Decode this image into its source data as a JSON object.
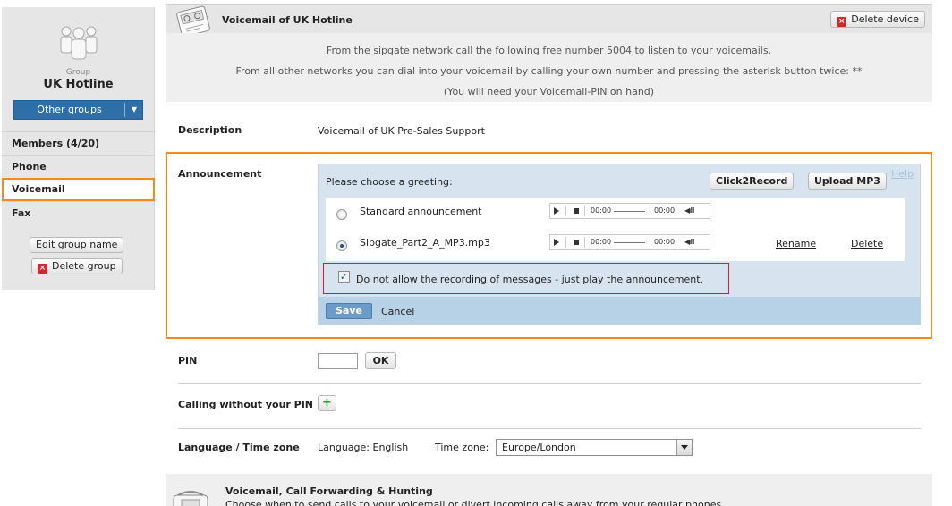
{
  "sidebar": {
    "group_caption": "Group",
    "group_name": "UK Hotline",
    "other_groups_label": "Other groups",
    "nav": [
      {
        "label": "Members (4/20)"
      },
      {
        "label": "Phone"
      },
      {
        "label": "Voicemail",
        "active": true
      },
      {
        "label": "Fax"
      }
    ],
    "edit_group_name": "Edit group name",
    "delete_group": "Delete group"
  },
  "header": {
    "title": "Voicemail of UK Hotline",
    "delete_device": "Delete device"
  },
  "info": {
    "line1": "From the sipgate network call the following free number 5004   to listen to your voicemails.",
    "line2": "From all other networks you can dial into your voicemail by calling your own number and pressing the asterisk button twice: **",
    "line3": "(You will need your Voicemail-PIN on hand)"
  },
  "description": {
    "label": "Description",
    "value": "Voicemail of UK Pre-Sales Support"
  },
  "announcement": {
    "label": "Announcement",
    "prompt": "Please choose a greeting:",
    "click2record": "Click2Record",
    "upload_mp3": "Upload MP3",
    "help": "Help",
    "greetings": [
      {
        "name": "Standard announcement",
        "selected": false
      },
      {
        "name": "Sipgate_Part2_A_MP3.mp3",
        "selected": true,
        "rename": "Rename",
        "delete": "Delete"
      }
    ],
    "player_time": "00:00",
    "no_recording_label": "Do not allow the recording of messages - just play the announcement.",
    "no_recording_checked": true,
    "save": "Save",
    "cancel": "Cancel"
  },
  "pin": {
    "label": "PIN",
    "value": "",
    "ok": "OK"
  },
  "calling_without_pin": {
    "label": "Calling without your PIN"
  },
  "language_time": {
    "label": "Language / Time zone",
    "language_text": "Language: English",
    "time_zone_label": "Time zone:",
    "time_zone_value": "Europe/London"
  },
  "next_section": {
    "title": "Voicemail, Call Forwarding & Hunting",
    "text": "Choose when to send calls to your voicemail or divert incoming calls away from your regular phones."
  },
  "colors": {
    "highlight": "#f08a24",
    "accent_blue": "#2e6fa8",
    "error_red": "#c9232a"
  }
}
